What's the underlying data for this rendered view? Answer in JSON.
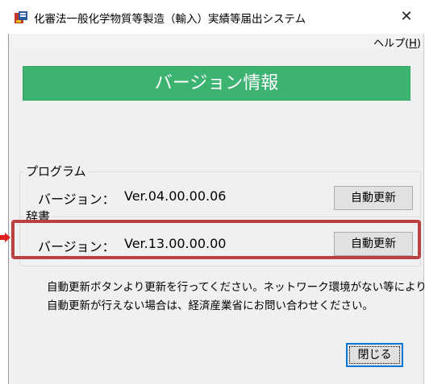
{
  "window": {
    "title": "化審法一般化学物質等製造（輸入）実績等届出システム",
    "close_glyph": "✕"
  },
  "menubar": {
    "help_label": "ヘルプ(",
    "help_accel": "H",
    "help_close": ")"
  },
  "banner": {
    "title": "バージョン情報",
    "color": "#3cb371"
  },
  "program": {
    "group_title": "プログラム",
    "version_label": "バージョン：",
    "version_value": "Ver.04.00.00.06",
    "update_button": "自動更新"
  },
  "dictionary": {
    "group_title": "辞書",
    "version_label": "バージョン：",
    "version_value": "Ver.13.00.00.00",
    "update_button": "自動更新"
  },
  "notice": {
    "line1": "自動更新ボタンより更新を行ってください。ネットワーク環境がない等により",
    "line2": "自動更新が行えない場合は、経済産業省にお問い合わせください。"
  },
  "footer": {
    "close_button": "閉じる"
  },
  "annotation": {
    "highlight_color": "#b9413f",
    "arrow_color": "#e02020"
  }
}
